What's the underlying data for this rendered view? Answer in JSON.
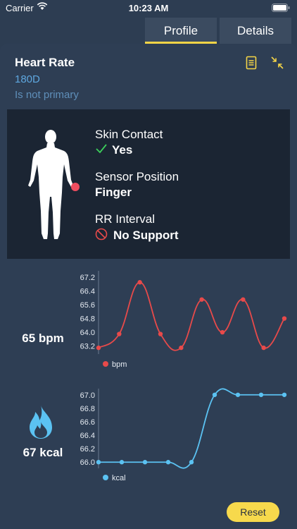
{
  "status": {
    "carrier": "Carrier",
    "time": "10:23 AM"
  },
  "tabs": [
    {
      "label": "Profile",
      "active": true
    },
    {
      "label": "Details",
      "active": false
    }
  ],
  "device": {
    "name": "Heart Rate",
    "model": "180D",
    "primary": "Is not primary",
    "icons": [
      "document-icon",
      "collapse-icon"
    ]
  },
  "sensor": {
    "skin_contact_label": "Skin Contact",
    "skin_contact_value": "Yes",
    "position_label": "Sensor Position",
    "position_value": "Finger",
    "rr_label": "RR Interval",
    "rr_value": "No Support"
  },
  "metrics": {
    "heart_rate": "65 bpm",
    "calories": "67 kcal"
  },
  "colors": {
    "accent": "#f5d547",
    "bpm": "#e84a4a",
    "kcal": "#5bc2f2",
    "ok": "#3ccf5b",
    "error": "#e84a4a"
  },
  "reset_label": "Reset",
  "chart_data": [
    {
      "type": "line",
      "series": [
        {
          "name": "bpm",
          "values": [
            63.1,
            63.9,
            66.9,
            63.9,
            63.1,
            65.9,
            64.0,
            65.9,
            63.1,
            64.8
          ]
        }
      ],
      "x": [
        0,
        1,
        2,
        3,
        4,
        5,
        6,
        7,
        8,
        9
      ],
      "yticks": [
        "67.2",
        "66.4",
        "65.6",
        "64.8",
        "64.0",
        "63.2"
      ],
      "ylim": [
        62.9,
        67.4
      ],
      "legend": "bottom-left"
    },
    {
      "type": "line",
      "series": [
        {
          "name": "kcal",
          "values": [
            66.0,
            66.0,
            66.0,
            66.0,
            66.0,
            67.0,
            67.0,
            67.0,
            67.0
          ]
        }
      ],
      "x": [
        0,
        1,
        2,
        3,
        4,
        5,
        6,
        7,
        8
      ],
      "yticks": [
        "67.0",
        "66.8",
        "66.6",
        "66.4",
        "66.2",
        "66.0"
      ],
      "ylim": [
        65.95,
        67.05
      ],
      "legend": "bottom-left"
    }
  ]
}
